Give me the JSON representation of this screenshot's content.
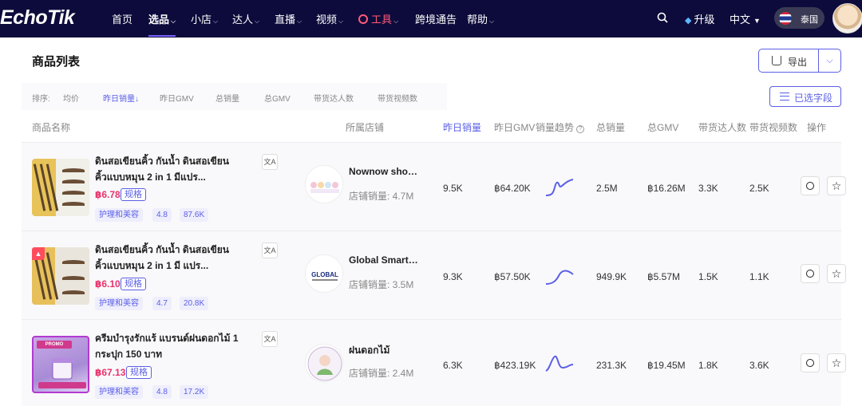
{
  "logo": "EchoTik",
  "nav": {
    "items": [
      {
        "label": "首页",
        "caret": false
      },
      {
        "label": "选品",
        "caret": true
      },
      {
        "label": "小店",
        "caret": true
      },
      {
        "label": "达人",
        "caret": true
      },
      {
        "label": "直播",
        "caret": true
      },
      {
        "label": "视频",
        "caret": true
      },
      {
        "label": "工具",
        "caret": true
      },
      {
        "label": "跨境通告",
        "caret": false
      },
      {
        "label": "帮助",
        "caret": true
      }
    ],
    "upgrade": "升级",
    "language": "中文",
    "country": "泰国"
  },
  "page": {
    "title": "商品列表",
    "export": "导出",
    "fields_button": "已选字段"
  },
  "sort": {
    "label": "排序:",
    "options": [
      "均价",
      "昨日销量↓",
      "昨日GMV",
      "总销量",
      "总GMV",
      "带货达人数",
      "带货视频数"
    ],
    "active": "昨日销量↓"
  },
  "columns": [
    "商品名称",
    "所属店铺",
    "昨日销量",
    "昨日GMV",
    "销量趋势",
    "总销量",
    "总GMV",
    "带货达人数",
    "带货视频数",
    "操作"
  ],
  "rows": [
    {
      "name": "ดินสอเขียนคิ้ว กันน้ำ ดินสอเขียนคิ้วแบบหมุน 2 in 1 มีแปร...",
      "price": "฿6.78",
      "spec": "规格",
      "category": "护理和美容",
      "rating": "4.8",
      "reviews": "87.6K",
      "shop_name": "Nownow shop ...",
      "shop_sales": "店铺销量: 4.7M",
      "yesterday_sales": "9.5K",
      "yesterday_gmv": "฿64.20K",
      "total_sales": "2.5M",
      "total_gmv": "฿16.26M",
      "creators": "3.3K",
      "videos": "2.5K"
    },
    {
      "name": "ดินสอเขียนคิ้ว กันน้ำ ดินสอเขียนคิ้วแบบหมุน 2 in 1 มี แปร...",
      "price": "฿6.10",
      "spec": "规格",
      "category": "护理和美容",
      "rating": "4.7",
      "reviews": "20.8K",
      "shop_name": "Global Smart S...",
      "shop_sales": "店铺销量: 3.5M",
      "yesterday_sales": "9.3K",
      "yesterday_gmv": "฿57.50K",
      "total_sales": "949.9K",
      "total_gmv": "฿5.57M",
      "creators": "1.5K",
      "videos": "1.1K"
    },
    {
      "name": "ครีมบำรุงรักแร้ แบรนด์ฝนดอกไม้ 1 กระปุก 150 บาท",
      "price": "฿67.13",
      "spec": "规格",
      "category": "护理和美容",
      "rating": "4.8",
      "reviews": "17.2K",
      "shop_name": "ฝนดอกไม้",
      "shop_sales": "店铺销量: 2.4M",
      "yesterday_sales": "6.3K",
      "yesterday_gmv": "฿423.19K",
      "total_sales": "231.3K",
      "total_gmv": "฿19.45M",
      "creators": "1.8K",
      "videos": "3.6K"
    }
  ],
  "colors": {
    "nav_bg": "#0d0b3b",
    "accent": "#5b5fe6",
    "price": "#e8336b",
    "tools": "#ff5a7a"
  },
  "icons": [
    "search-icon",
    "diamond-icon",
    "flag-th-icon",
    "upload-icon",
    "list-icon",
    "translate-icon",
    "circle-icon",
    "star-icon",
    "trend-icon"
  ]
}
